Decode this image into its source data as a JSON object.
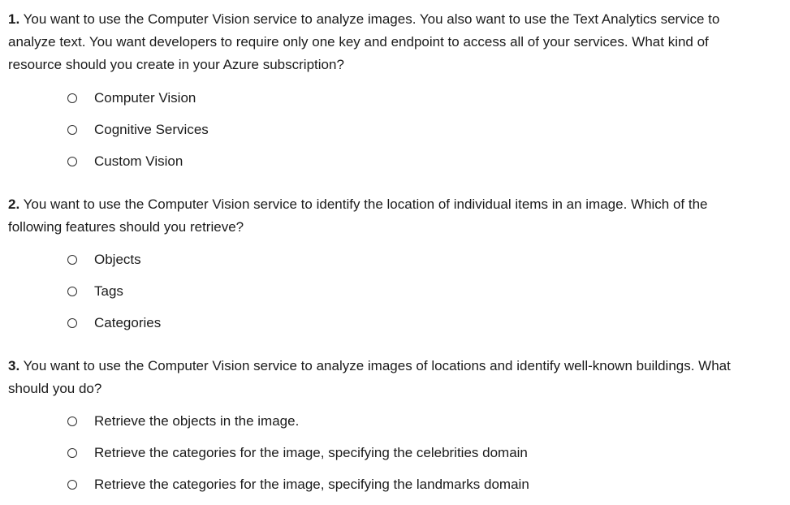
{
  "questions": [
    {
      "number": "1.",
      "text": " You want to use the Computer Vision service to analyze images. You also want to use the Text Analytics service to analyze text. You want developers to require only one key and endpoint to access all of your services. What kind of resource should you create in your Azure subscription?",
      "options": [
        "Computer Vision",
        "Cognitive Services",
        "Custom Vision"
      ]
    },
    {
      "number": "2.",
      "text": " You want to use the Computer Vision service to identify the location of individual items in an image. Which of the following features should you retrieve?",
      "options": [
        "Objects",
        "Tags",
        "Categories"
      ]
    },
    {
      "number": "3.",
      "text": " You want to use the Computer Vision service to analyze images of locations and identify well-known buildings. What should you do?",
      "options": [
        "Retrieve the objects in the image.",
        "Retrieve the categories for the image, specifying the celebrities domain",
        "Retrieve the categories for the image, specifying the landmarks domain"
      ]
    }
  ]
}
